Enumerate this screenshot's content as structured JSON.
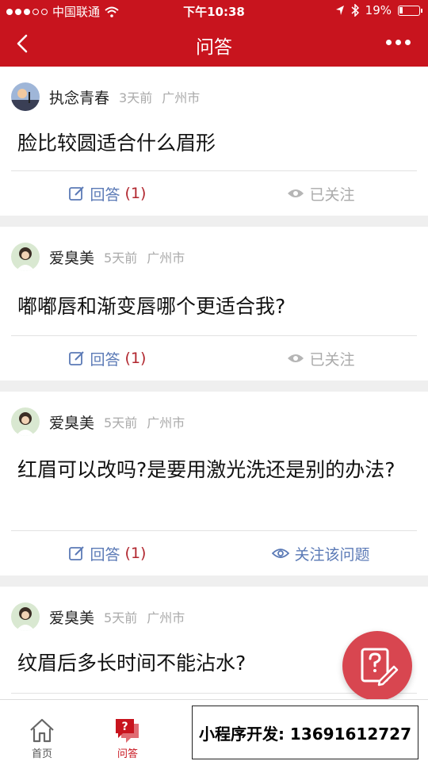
{
  "status_bar": {
    "carrier": "中国联通",
    "time": "下午10:38",
    "battery": "19%",
    "battery_level": 0.19
  },
  "header": {
    "title": "问答"
  },
  "questions": [
    {
      "user": "执念青春",
      "time": "3天前",
      "location": "广州市",
      "question": "脸比较圆适合什么眉形",
      "answer_label": "回答",
      "answer_count": "(1)",
      "follow_label": "已关注",
      "follow_active": false
    },
    {
      "user": "爱臭美",
      "time": "5天前",
      "location": "广州市",
      "question": "嘟嘟唇和渐变唇哪个更适合我?",
      "answer_label": "回答",
      "answer_count": "(1)",
      "follow_label": "已关注",
      "follow_active": false
    },
    {
      "user": "爱臭美",
      "time": "5天前",
      "location": "广州市",
      "question": "红眉可以改吗?是要用激光洗还是别的办法?",
      "answer_label": "回答",
      "answer_count": "(1)",
      "follow_label": "关注该问题",
      "follow_active": true
    },
    {
      "user": "爱臭美",
      "time": "5天前",
      "location": "广州市",
      "question": "纹眉后多长时间不能沾水?",
      "answer_label": "",
      "answer_count": "",
      "follow_label": "",
      "follow_active": false
    }
  ],
  "tabbar": {
    "home": "首页",
    "qa": "问答"
  },
  "banner": {
    "text": "小程序开发: 13691612727"
  },
  "colors": {
    "brand": "#c8141e",
    "link": "#5b7ab6",
    "count": "#b1262e"
  },
  "icons": {
    "back": "chevron-left-icon",
    "more": "more-dots-icon",
    "wifi": "wifi-icon",
    "answer": "edit-icon",
    "follow": "eye-icon",
    "fab": "ask-question-icon",
    "home": "home-icon",
    "qa": "question-chat-icon"
  }
}
